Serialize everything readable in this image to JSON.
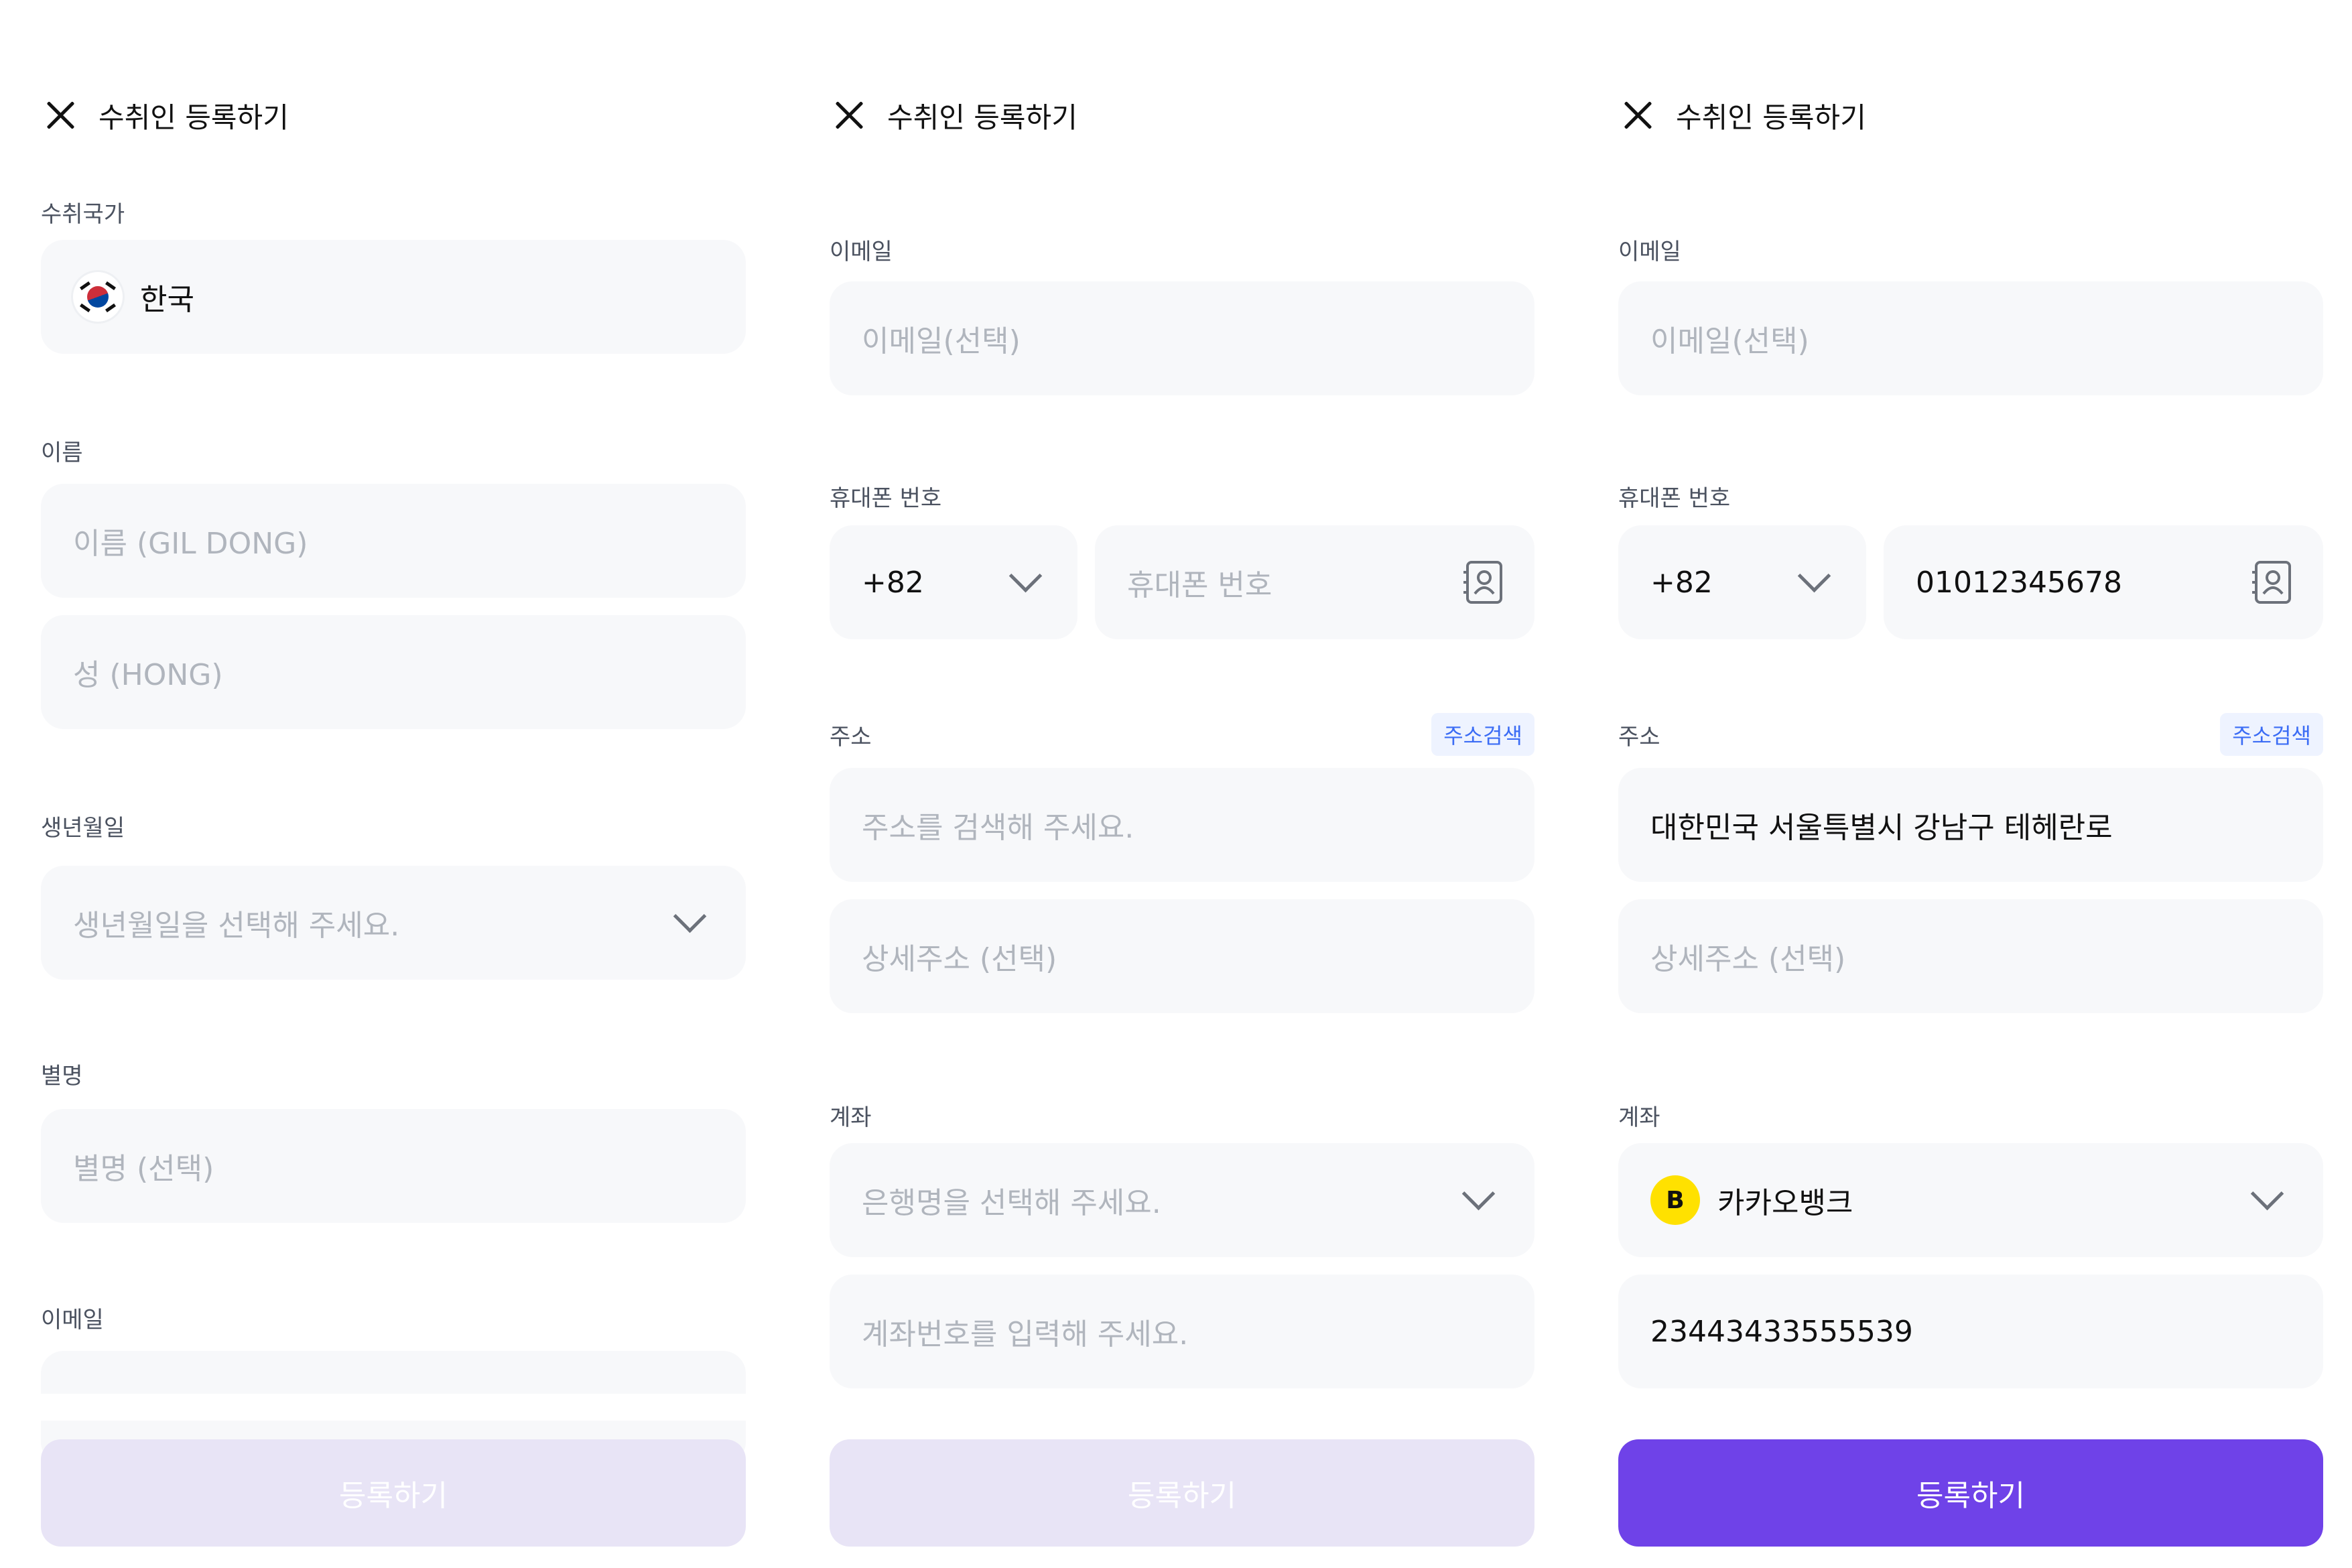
{
  "screens": [
    {
      "title": "수취인 등록하기",
      "country_label": "수취국가",
      "country_value": "한국",
      "name_label": "이름",
      "first_name_placeholder": "이름 (GIL DONG)",
      "last_name_placeholder": "성 (HONG)",
      "birth_label": "생년월일",
      "birth_placeholder": "생년월일을 선택해 주세요.",
      "nickname_label": "별명",
      "nickname_placeholder": "별명 (선택)",
      "email_label": "이메일",
      "submit_label": "등록하기"
    },
    {
      "title": "수취인 등록하기",
      "email_label": "이메일",
      "email_placeholder": "이메일(선택)",
      "phone_label": "휴대폰 번호",
      "phone_code": "+82",
      "phone_placeholder": "휴대폰 번호",
      "address_label": "주소",
      "address_search_label": "주소검색",
      "address_placeholder": "주소를 검색해 주세요.",
      "address_detail_placeholder": "상세주소 (선택)",
      "account_label": "계좌",
      "bank_placeholder": "은행명을 선택해 주세요.",
      "account_number_placeholder": "계좌번호를 입력해 주세요.",
      "submit_label": "등록하기"
    },
    {
      "title": "수취인 등록하기",
      "email_label": "이메일",
      "email_placeholder": "이메일(선택)",
      "phone_label": "휴대폰 번호",
      "phone_code": "+82",
      "phone_value": "01012345678",
      "address_label": "주소",
      "address_search_label": "주소검색",
      "address_value": "대한민국 서울특별시 강남구 테헤란로",
      "address_detail_placeholder": "상세주소 (선택)",
      "account_label": "계좌",
      "bank_logo_letter": "B",
      "bank_value": "카카오뱅크",
      "account_number_value": "23443433555539",
      "submit_label": "등록하기"
    }
  ],
  "colors": {
    "primary": "#6f42e8",
    "primary_disabled": "#e8e4f6",
    "field_bg": "#f7f8fa",
    "placeholder": "#b0b5bd",
    "link": "#3b6cf5",
    "kakao_yellow": "#ffe100"
  },
  "icons": [
    "close-icon",
    "korea-flag-icon",
    "chevron-down-icon",
    "contact-book-icon",
    "kakaobank-logo-icon"
  ]
}
